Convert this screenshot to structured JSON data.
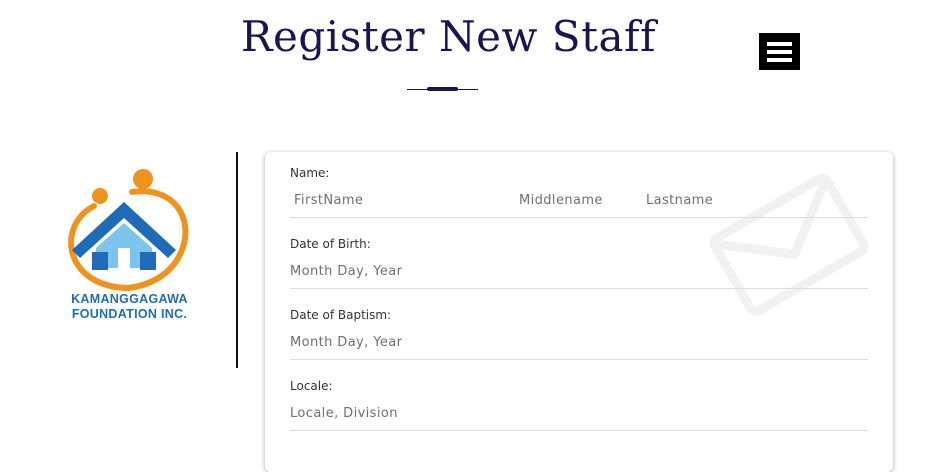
{
  "page": {
    "title": "Register New Staff"
  },
  "logo": {
    "line1": "KAMANGGAGAWA",
    "line2": "FOUNDATION INC."
  },
  "form": {
    "name": {
      "label": "Name:",
      "first_placeholder": "FirstName",
      "middle_placeholder": "Middlename",
      "last_placeholder": "Lastname"
    },
    "dob": {
      "label": "Date of Birth:",
      "placeholder": "Month Day, Year"
    },
    "baptism": {
      "label": "Date of Baptism:",
      "placeholder": "Month Day, Year"
    },
    "locale": {
      "label": "Locale:",
      "placeholder": "Locale, Division"
    }
  },
  "colors": {
    "title": "#1a1550",
    "logo_blue": "#1f6bb8",
    "logo_orange": "#f0931e"
  },
  "icons": {
    "menu": "hamburger-menu-icon",
    "watermark": "envelope-icon"
  }
}
